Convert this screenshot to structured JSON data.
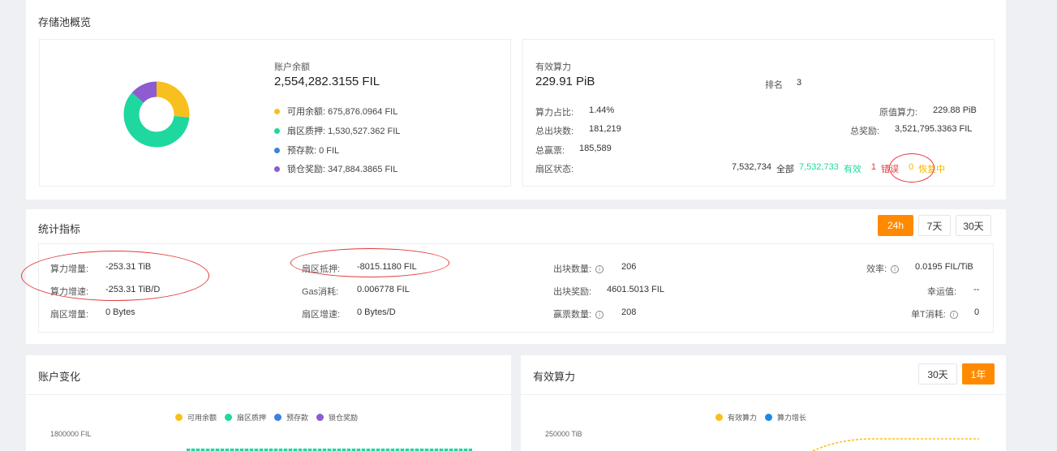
{
  "pool_overview": {
    "title": "存储池概览",
    "balance_label": "账户余额",
    "balance_value": "2,554,282.3155 FIL",
    "legend": [
      {
        "label": "可用余额: 675,876.0964 FIL",
        "color": "#f8c01c"
      },
      {
        "label": "扇区质押: 1,530,527.362 FIL",
        "color": "#1ed8a0"
      },
      {
        "label": "预存款: 0 FIL",
        "color": "#3b82e0"
      },
      {
        "label": "锁仓奖励: 347,884.3865 FIL",
        "color": "#8e5bd0"
      }
    ],
    "donut": {
      "slices": [
        {
          "name": "可用余额",
          "value": 675876.0964,
          "color": "#f8c01c"
        },
        {
          "name": "扇区质押",
          "value": 1530527.362,
          "color": "#1ed8a0"
        },
        {
          "name": "预存款",
          "value": 0,
          "color": "#3b82e0"
        },
        {
          "name": "锁仓奖励",
          "value": 347884.3865,
          "color": "#8e5bd0"
        }
      ]
    },
    "power_label": "有效算力",
    "power_value": "229.91 PiB",
    "rank_label": "排名",
    "rank_value": "3",
    "ratio_label": "算力占比:",
    "ratio_value": "1.44%",
    "raw_label": "原值算力:",
    "raw_value": "229.88 PiB",
    "blocks_label": "总出块数:",
    "blocks_value": "181,219",
    "reward_label": "总奖励:",
    "reward_value": "3,521,795.3363 FIL",
    "tickets_label": "总赢票:",
    "tickets_value": "185,589",
    "sector_label": "扇区状态:",
    "sector_total": "7,532,734",
    "sector_total_label": "全部",
    "sector_active": "7,532,733",
    "sector_active_label": "有效",
    "sector_faulty": "1",
    "sector_faulty_label": "错误",
    "sector_recovering": "0",
    "sector_recovering_label": "恢复中"
  },
  "stats": {
    "title": "统计指标",
    "tabs": [
      {
        "label": "24h",
        "active": true
      },
      {
        "label": "7天",
        "active": false
      },
      {
        "label": "30天",
        "active": false
      }
    ],
    "power_growth_label": "算力增量:",
    "power_growth_value": "-253.31 TiB",
    "power_speed_label": "算力增速:",
    "power_speed_value": "-253.31 TiB/D",
    "sector_growth_label": "扇区增量:",
    "sector_growth_value": "0 Bytes",
    "pledge_label": "扇区抵押:",
    "pledge_value": "-8015.1180 FIL",
    "gas_label": "Gas消耗:",
    "gas_value": "0.006778 FIL",
    "sector_speed_label": "扇区增速:",
    "sector_speed_value": "0 Bytes/D",
    "block_count_label": "出块数量:",
    "block_count_value": "206",
    "block_reward_label": "出块奖励:",
    "block_reward_value": "4601.5013 FIL",
    "win_count_label": "赢票数量:",
    "win_count_value": "208",
    "efficiency_label": "效率:",
    "efficiency_value": "0.0195 FIL/TiB",
    "luck_label": "幸运值:",
    "luck_value": "--",
    "unit_cost_label": "单T消耗:",
    "unit_cost_value": "0",
    "info_glyph": "i"
  },
  "account_change": {
    "title": "账户变化",
    "legend": [
      {
        "label": "可用余额",
        "color": "#f8c01c"
      },
      {
        "label": "扇区质押",
        "color": "#1ed8a0"
      },
      {
        "label": "预存款",
        "color": "#3b82e0"
      },
      {
        "label": "锁仓奖励",
        "color": "#8e5bd0"
      }
    ],
    "y_tick": "1800000 FIL"
  },
  "power_chart": {
    "title": "有效算力",
    "tabs": [
      {
        "label": "30天",
        "active": false
      },
      {
        "label": "1年",
        "active": true
      }
    ],
    "legend": [
      {
        "label": "有效算力",
        "color": "#f8c01c"
      },
      {
        "label": "算力增长",
        "color": "#1e88e5"
      }
    ],
    "y_tick": "250000 TiB"
  }
}
